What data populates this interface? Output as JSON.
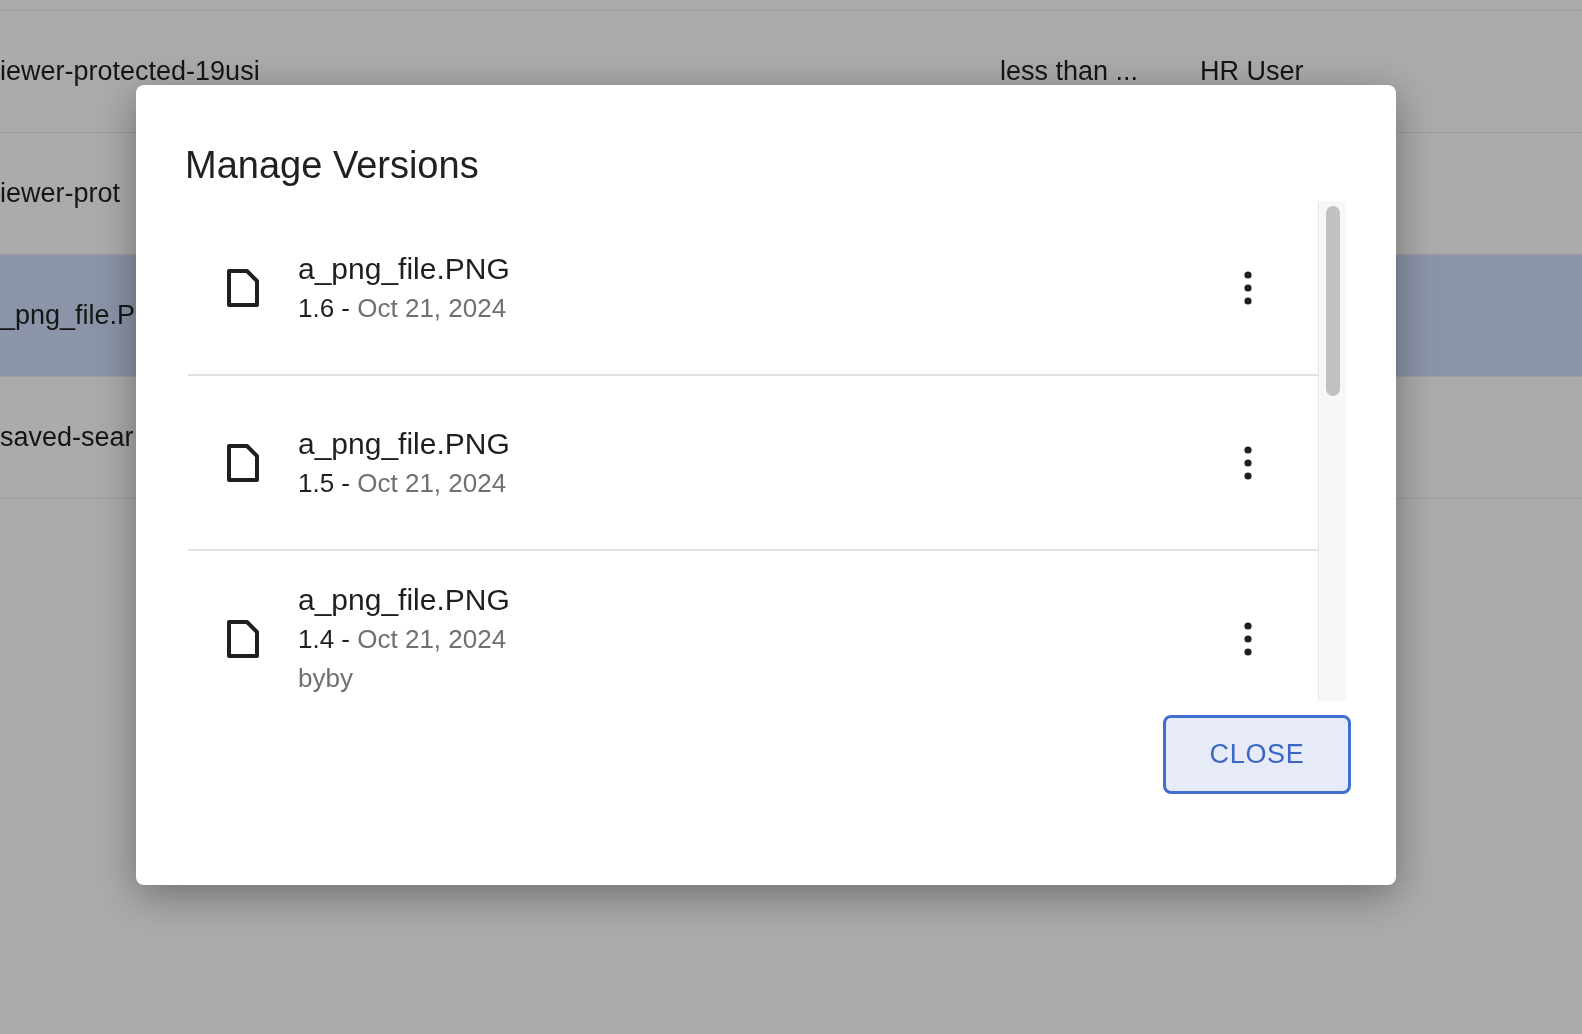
{
  "background_table": {
    "rows": [
      {
        "name": "iewer-protected-19usi",
        "column_2": "less than ...",
        "column_3": "HR User",
        "selected": false
      },
      {
        "name": "iewer-prot",
        "selected": false
      },
      {
        "name": "_png_file.P",
        "selected": true
      },
      {
        "name": "saved-sear",
        "selected": false
      }
    ]
  },
  "dialog": {
    "title": "Manage Versions",
    "versions": [
      {
        "file_name": "a_png_file.PNG",
        "version": "1.6 -",
        "date": "Oct 21, 2024"
      },
      {
        "file_name": "a_png_file.PNG",
        "version": "1.5 -",
        "date": "Oct 21, 2024"
      },
      {
        "file_name": "a_png_file.PNG",
        "version": "1.4 -",
        "date": "Oct 21, 2024",
        "comment": "byby"
      }
    ],
    "close_button": "CLOSE"
  }
}
